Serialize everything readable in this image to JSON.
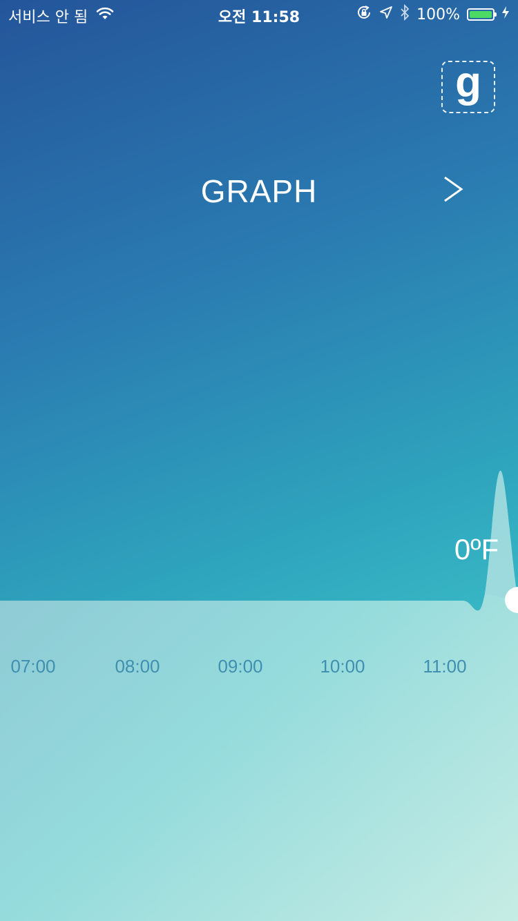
{
  "status_bar": {
    "carrier": "서비스 안 됨",
    "time": "오전 11:58",
    "battery_percent": "100%",
    "icons": [
      "wifi-icon",
      "rotation-lock-icon",
      "location-arrow-icon",
      "bluetooth-icon",
      "battery-icon",
      "charging-bolt-icon"
    ],
    "battery_color": "#4cd964"
  },
  "header": {
    "logo_letter": "g",
    "title": "GRAPH",
    "next_icon": "chevron-right-icon"
  },
  "graph": {
    "current_value": "0ºF",
    "time_labels": [
      "07:00",
      "08:00",
      "09:00",
      "10:00",
      "11:00"
    ]
  },
  "colors": {
    "gradient_top": "#24559a",
    "gradient_bottom": "#5ccad0",
    "axis_text": "#3f8fb0"
  }
}
